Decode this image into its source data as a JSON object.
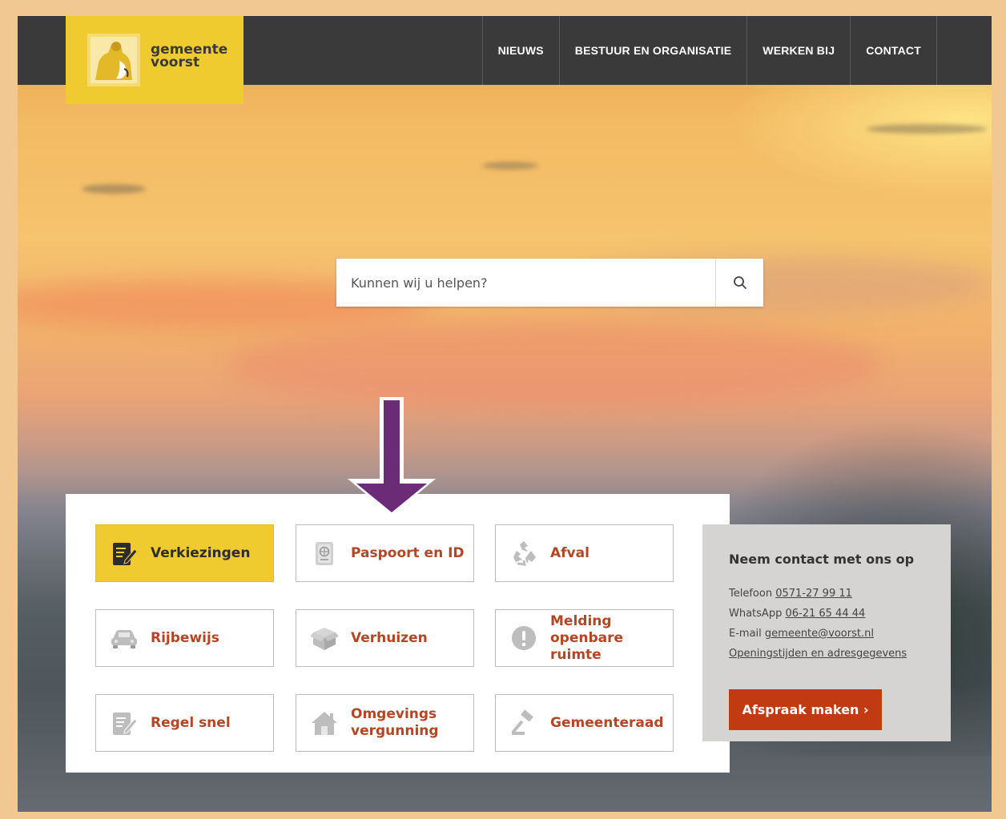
{
  "header": {
    "logo": {
      "line1": "gemeente",
      "line2": "voorst"
    },
    "nav": [
      "NIEUWS",
      "BESTUUR EN ORGANISATIE",
      "WERKEN BIJ",
      "CONTACT"
    ]
  },
  "search": {
    "placeholder": "Kunnen wij u helpen?",
    "icon": "search-icon"
  },
  "tiles": [
    {
      "label": "Verkiezingen",
      "icon": "ballot-edit-icon",
      "active": true
    },
    {
      "label": "Paspoort en ID",
      "icon": "passport-icon"
    },
    {
      "label": "Afval",
      "icon": "recycle-icon"
    },
    {
      "label": "Rijbewijs",
      "icon": "car-icon"
    },
    {
      "label": "Verhuizen",
      "icon": "moving-box-icon"
    },
    {
      "label": "Melding openbare ruimte",
      "icon": "alert-icon"
    },
    {
      "label": "Regel snel",
      "icon": "form-edit-icon"
    },
    {
      "label": "Omgevings vergunning",
      "icon": "house-icon"
    },
    {
      "label": "Gemeenteraad",
      "icon": "gavel-icon"
    }
  ],
  "contact": {
    "title": "Neem contact met ons op",
    "phone_label": "Telefoon",
    "phone": "0571-27 99 11",
    "whatsapp_label": "WhatsApp",
    "whatsapp": "06-21 65 44 44",
    "email_label": "E-mail",
    "email": "gemeente@voorst.nl",
    "hours_link": "Openingstijden en adresgegevens",
    "button": "Afspraak maken ›"
  },
  "colors": {
    "accent_yellow": "#efcb2f",
    "link_red": "#b54523",
    "button_red": "#c23a12",
    "header_dark": "#3a3a3a",
    "annotation_arrow": "#6b2b77"
  }
}
